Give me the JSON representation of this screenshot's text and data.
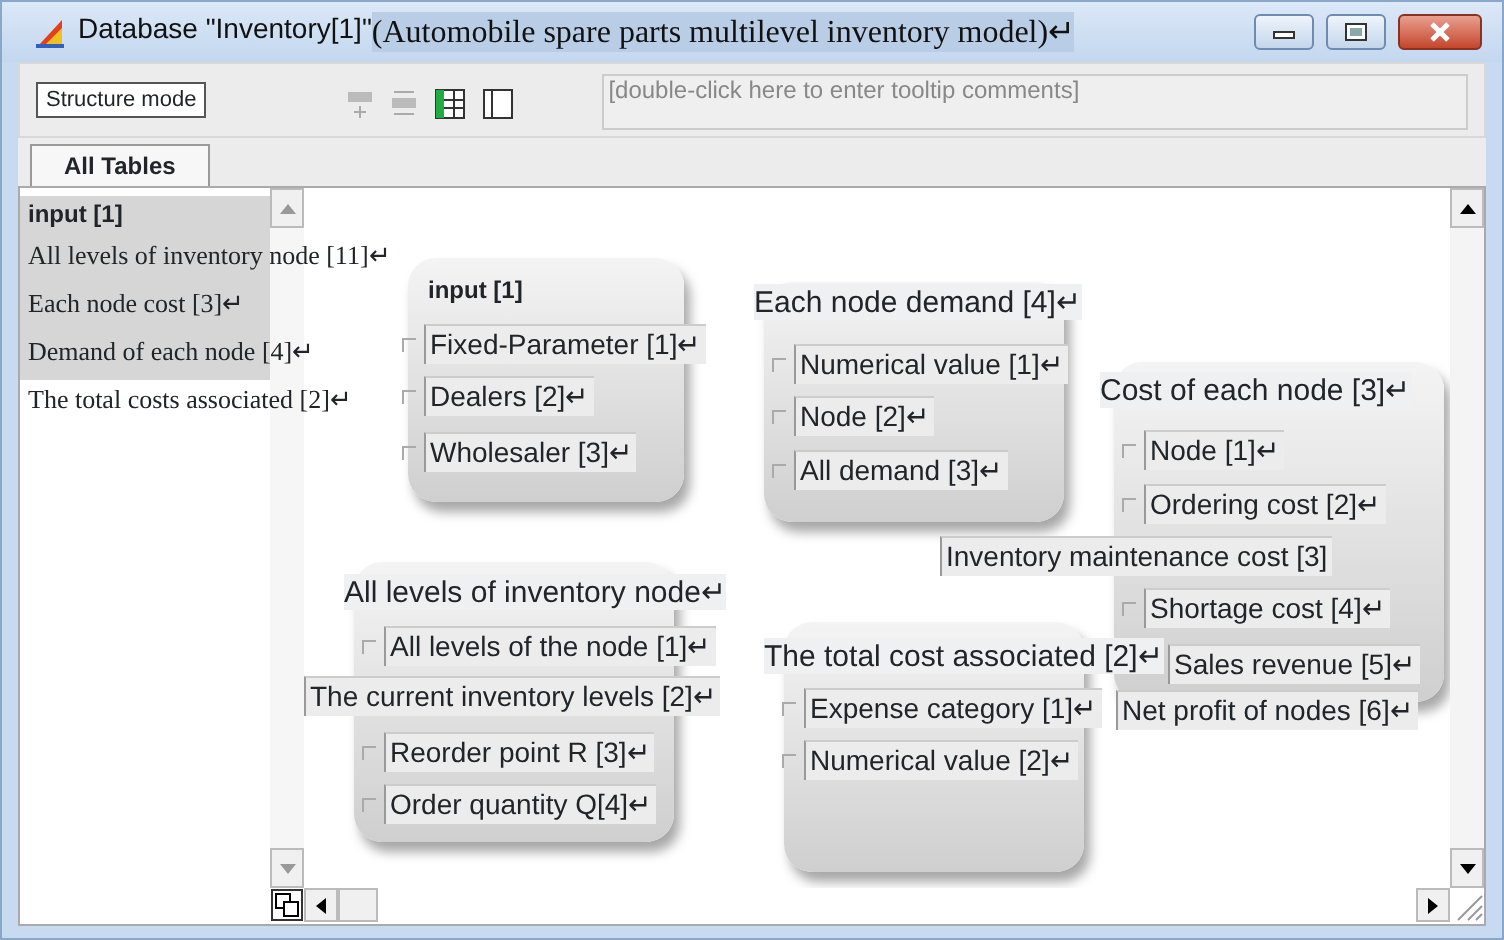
{
  "window": {
    "title_parts": [
      {
        "text": "Database \"Inventory[1]\" ",
        "kind": "plain"
      },
      {
        "text": "(Automobile spare parts multilevel inventory model)↵",
        "kind": "highlight"
      }
    ]
  },
  "toolbar": {
    "mode_dropdown": "Structure mode",
    "comment_field": {
      "placeholder": "[double-click here to enter tooltip comments]"
    }
  },
  "tabs": [
    {
      "label": "All Tables",
      "selected": true
    }
  ],
  "table_list": [
    {
      "label": "input [1]",
      "kind": "header",
      "highlighted": true
    },
    {
      "label": "All levels of inventory node [11]↵",
      "kind": "item",
      "highlighted": true
    },
    {
      "label": "Each node cost [3]↵",
      "kind": "item",
      "highlighted": true
    },
    {
      "label": "Demand of each node [4]↵",
      "kind": "item",
      "highlighted": true
    },
    {
      "label": "The total costs associated [2]↵",
      "kind": "item",
      "highlighted": false
    }
  ],
  "tables": [
    {
      "title": "input [1]",
      "kind": "header",
      "fields": [
        {
          "label": "Fixed-Parameter [1]↵"
        },
        {
          "label": "Dealers [2]↵"
        },
        {
          "label": "Wholesaler [3]↵"
        }
      ]
    },
    {
      "title": "Each node demand [4]↵",
      "kind": "label",
      "fields": [
        {
          "label": "Numerical value [1]↵"
        },
        {
          "label": "Node [2]↵"
        },
        {
          "label": "All demand [3]↵"
        }
      ]
    },
    {
      "title": "Cost of each node [3]↵",
      "kind": "label",
      "fields": [
        {
          "label": "Node [1]↵"
        },
        {
          "label": "Ordering cost [2]↵"
        },
        {
          "label": "Inventory maintenance cost [3]"
        },
        {
          "label": "Shortage cost [4]↵"
        },
        {
          "label": "Sales revenue [5]↵"
        },
        {
          "label": "Net profit of nodes [6]↵"
        }
      ]
    },
    {
      "title": "All levels of inventory node↵",
      "kind": "label",
      "fields": [
        {
          "label": "All levels of the node [1]↵"
        },
        {
          "label": "The current inventory levels [2]↵"
        },
        {
          "label": "Reorder point R [3]↵"
        },
        {
          "label": "Order quantity Q[4]↵"
        }
      ]
    },
    {
      "title": "The total cost associated [2]↵",
      "kind": "label",
      "fields": [
        {
          "label": "Expense category [1]↵"
        },
        {
          "label": "Numerical value [2]↵"
        }
      ]
    }
  ]
}
